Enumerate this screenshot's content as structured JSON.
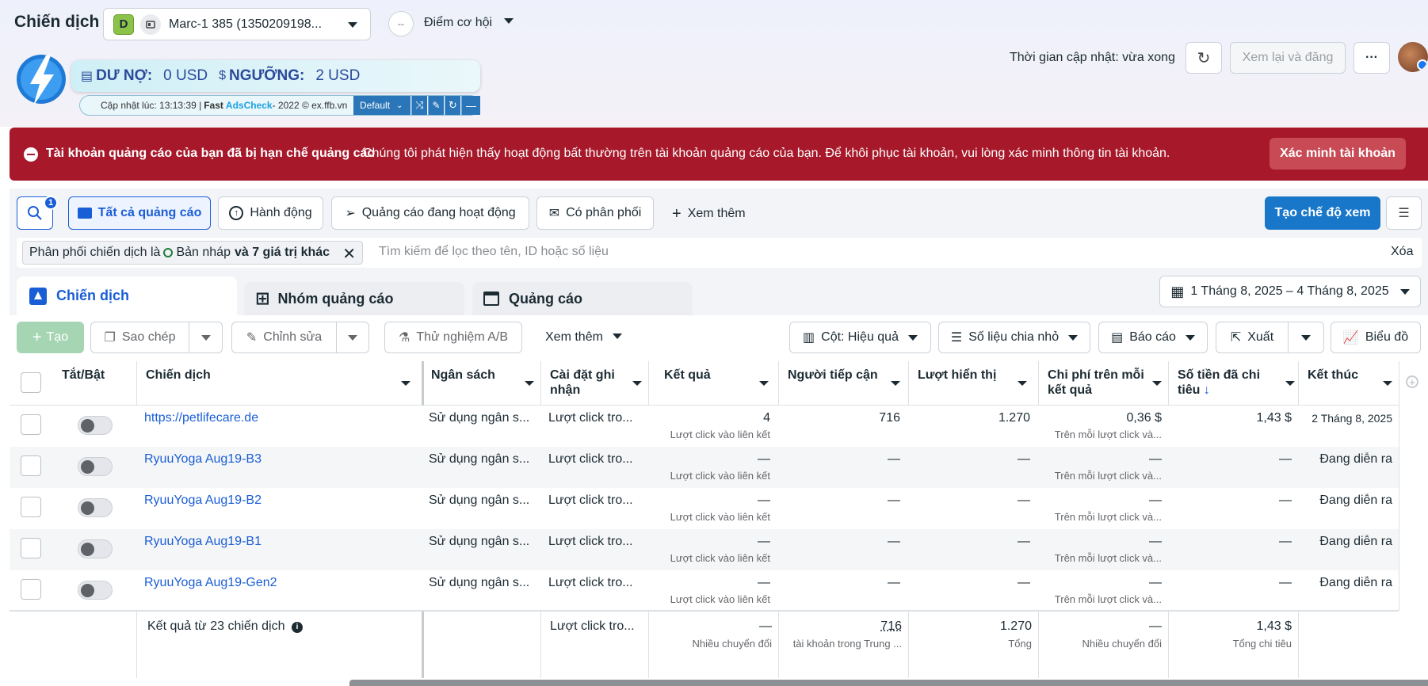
{
  "header": {
    "title": "Chiến dịch",
    "account_badge": "D",
    "account_name": "Marc-1 385 (1350209198...",
    "opportunity_label": "Điểm cơ hội",
    "opportunity_score": "--",
    "updated_text": "Thời gian cập nhật: vừa xong",
    "review_publish": "Xem lại và đăng",
    "more": "···"
  },
  "ext": {
    "debt_label": "DƯ NỢ:",
    "debt_value": "0 USD",
    "threshold_label": "NGƯỠNG:",
    "threshold_value": "2 USD",
    "updated_prefix": "Cập nhật lúc: 13:13:39 | ",
    "fast": "Fast",
    "adscheck": "AdsCheck",
    "suffix": " - 2022 © ex.ffb.vn",
    "mode": "Default"
  },
  "alert": {
    "title": "Tài khoản quảng cáo của bạn đã bị hạn chế quảng cáo",
    "message": "Chúng tôi phát hiện thấy hoạt động bất thường trên tài khoản quảng cáo của bạn. Để khôi phục tài khoản, vui lòng xác minh thông tin tài khoản.",
    "button": "Xác minh tài khoản"
  },
  "filters": {
    "search_badge": "1",
    "chips": [
      "Tất cả quảng cáo",
      "Hành động",
      "Quảng cáo đang hoạt động",
      "Có phân phối"
    ],
    "more": "Xem thêm",
    "create_view": "Tạo chế độ xem",
    "active_filter_prefix": "Phân phối chiến dịch là ",
    "active_filter_value": "Bản nháp",
    "active_filter_suffix": "và 7 giá trị khác",
    "search_placeholder": "Tìm kiếm để lọc theo tên, ID hoặc số liệu",
    "clear": "Xóa"
  },
  "tabs": [
    "Chiến dịch",
    "Nhóm quảng cáo",
    "Quảng cáo"
  ],
  "date_range": "1 Tháng 8, 2025 – 4 Tháng 8, 2025",
  "toolbar": {
    "create": "Tạo",
    "duplicate": "Sao chép",
    "edit": "Chỉnh sửa",
    "ab_test": "Thử nghiệm A/B",
    "more": "Xem thêm",
    "columns": "Cột: Hiệu quả",
    "breakdown": "Số liệu chia nhỏ",
    "reports": "Báo cáo",
    "export": "Xuất",
    "charts": "Biểu đồ"
  },
  "table": {
    "headers": [
      "Tắt/Bật",
      "Chiến dịch",
      "Ngân sách",
      "Cài đặt ghi nhận",
      "Kết quả",
      "Người tiếp cận",
      "Lượt hiển thị",
      "Chi phí trên mỗi kết quả",
      "Số tiền đã chi tiêu",
      "Kết thúc"
    ],
    "rows": [
      {
        "name": "https://petlifecare.de",
        "budget": "Sử dụng ngân s...",
        "attribution": "Lượt click tro...",
        "results": "4",
        "results_sub": "Lượt click vào liên kết",
        "reach": "716",
        "impressions": "1.270",
        "cpr": "0,36 $",
        "cpr_sub": "Trên mỗi lượt click và...",
        "spent": "1,43 $",
        "end": "2 Tháng 8, 2025"
      },
      {
        "name": "RyuuYoga Aug19-B3",
        "budget": "Sử dụng ngân s...",
        "attribution": "Lượt click tro...",
        "results": "—",
        "results_sub": "Lượt click vào liên kết",
        "reach": "—",
        "impressions": "—",
        "cpr": "—",
        "cpr_sub": "Trên mỗi lượt click và...",
        "spent": "—",
        "end": "Đang diễn ra"
      },
      {
        "name": "RyuuYoga Aug19-B2",
        "budget": "Sử dụng ngân s...",
        "attribution": "Lượt click tro...",
        "results": "—",
        "results_sub": "Lượt click vào liên kết",
        "reach": "—",
        "impressions": "—",
        "cpr": "—",
        "cpr_sub": "Trên mỗi lượt click và...",
        "spent": "—",
        "end": "Đang diễn ra"
      },
      {
        "name": "RyuuYoga Aug19-B1",
        "budget": "Sử dụng ngân s...",
        "attribution": "Lượt click tro...",
        "results": "—",
        "results_sub": "Lượt click vào liên kết",
        "reach": "—",
        "impressions": "—",
        "cpr": "—",
        "cpr_sub": "Trên mỗi lượt click và...",
        "spent": "—",
        "end": "Đang diễn ra"
      },
      {
        "name": "RyuuYoga Aug19-Gen2",
        "budget": "Sử dụng ngân s...",
        "attribution": "Lượt click tro...",
        "results": "—",
        "results_sub": "Lượt click vào liên kết",
        "reach": "—",
        "impressions": "—",
        "cpr": "—",
        "cpr_sub": "Trên mỗi lượt click và...",
        "spent": "—",
        "end": "Đang diễn ra"
      }
    ],
    "summary": {
      "label": "Kết quả từ 23 chiến dịch",
      "attribution": "Lượt click tro...",
      "results": "—",
      "results_sub": "Nhiều chuyển đổi",
      "reach": "716",
      "reach_sub": "tài khoản trong Trung ...",
      "impressions": "1.270",
      "impressions_sub": "Tổng",
      "cpr": "—",
      "cpr_sub": "Nhiều chuyển đổi",
      "spent": "1,43 $",
      "spent_sub": "Tổng chi tiêu"
    }
  }
}
